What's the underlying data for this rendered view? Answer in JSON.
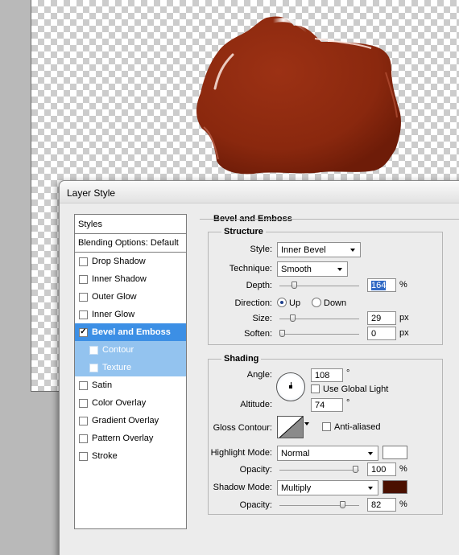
{
  "window": {
    "title": "Layer Style"
  },
  "styles_list": {
    "header": "Styles",
    "blending_options": "Blending Options: Default",
    "items": [
      {
        "label": "Drop Shadow",
        "checked": false
      },
      {
        "label": "Inner Shadow",
        "checked": false
      },
      {
        "label": "Outer Glow",
        "checked": false
      },
      {
        "label": "Inner Glow",
        "checked": false
      },
      {
        "label": "Bevel and Emboss",
        "checked": true,
        "selected": true
      },
      {
        "label": "Contour",
        "checked": false,
        "sub": true
      },
      {
        "label": "Texture",
        "checked": false,
        "sub": true
      },
      {
        "label": "Satin",
        "checked": false
      },
      {
        "label": "Color Overlay",
        "checked": false
      },
      {
        "label": "Gradient Overlay",
        "checked": false
      },
      {
        "label": "Pattern Overlay",
        "checked": false
      },
      {
        "label": "Stroke",
        "checked": false
      }
    ]
  },
  "bevel": {
    "title": "Bevel and Emboss",
    "structure": {
      "title": "Structure",
      "style_label": "Style:",
      "style_value": "Inner Bevel",
      "technique_label": "Technique:",
      "technique_value": "Smooth",
      "depth_label": "Depth:",
      "depth_value": "164",
      "depth_unit": "%",
      "depth_slider_fraction": 0.16,
      "direction_label": "Direction:",
      "direction_up": "Up",
      "direction_down": "Down",
      "direction_selected": "Up",
      "size_label": "Size:",
      "size_value": "29",
      "size_unit": "px",
      "size_slider_fraction": 0.14,
      "soften_label": "Soften:",
      "soften_value": "0",
      "soften_unit": "px",
      "soften_slider_fraction": 0.0
    },
    "shading": {
      "title": "Shading",
      "angle_label": "Angle:",
      "angle_value": "108",
      "angle_unit": "°",
      "use_global_light": "Use Global Light",
      "use_global_light_checked": false,
      "altitude_label": "Altitude:",
      "altitude_value": "74",
      "altitude_unit": "°",
      "gloss_contour_label": "Gloss Contour:",
      "anti_aliased": "Anti-aliased",
      "anti_aliased_checked": false,
      "highlight_mode_label": "Highlight Mode:",
      "highlight_mode_value": "Normal",
      "highlight_color": "#ffffff",
      "highlight_opacity_label": "Opacity:",
      "highlight_opacity_value": "100",
      "highlight_opacity_unit": "%",
      "highlight_opacity_fraction": 1.0,
      "shadow_mode_label": "Shadow Mode:",
      "shadow_mode_value": "Multiply",
      "shadow_color": "#4a1000",
      "shadow_opacity_label": "Opacity:",
      "shadow_opacity_value": "82",
      "shadow_opacity_unit": "%",
      "shadow_opacity_fraction": 0.82
    }
  },
  "colors": {
    "seal": "#8e2a10",
    "selection": "#3c8fe5",
    "sub_selection": "#93c3ef"
  }
}
